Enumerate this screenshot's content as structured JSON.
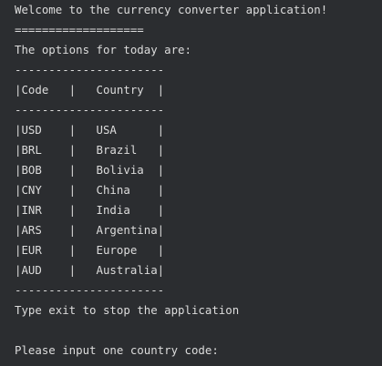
{
  "console": {
    "lines": [
      "Welcome to the currency converter application!",
      "===================",
      "The options for today are:",
      "----------------------",
      "|Code   |   Country  |",
      "----------------------",
      "|USD    |   USA      |",
      "|BRL    |   Brazil   |",
      "|BOB    |   Bolivia  |",
      "|CNY    |   China    |",
      "|INR    |   India    |",
      "|ARS    |   Argentina|",
      "|EUR    |   Europe   |",
      "|AUD    |   Australia|",
      "----------------------",
      "Type exit to stop the application",
      "",
      "Please input one country code:"
    ]
  },
  "colors": {
    "background": "#2b2d30",
    "text": "#dcdcdc"
  }
}
